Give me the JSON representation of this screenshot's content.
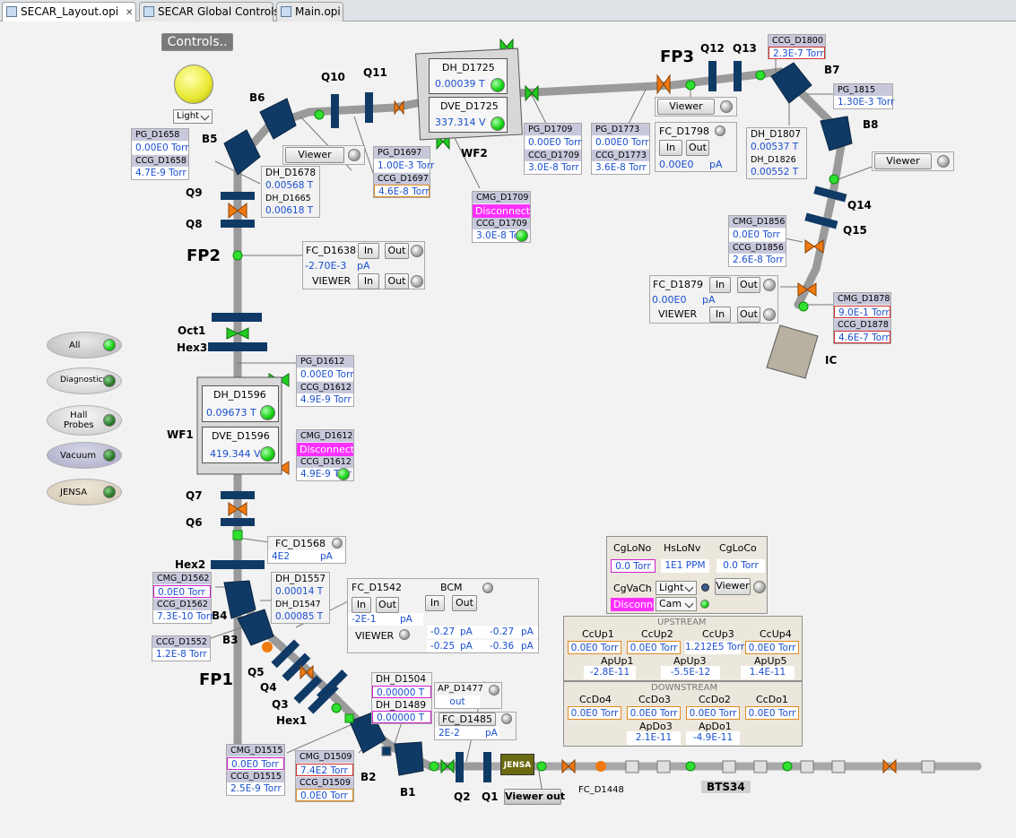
{
  "tabs": [
    {
      "label": "SECAR_Layout.opi"
    },
    {
      "label": "SECAR Global Controls"
    },
    {
      "label": "Main.opi"
    }
  ],
  "controls_btn": "Controls..",
  "light_select": "Light",
  "modes": [
    {
      "label": "All"
    },
    {
      "label": "Diagnostics"
    },
    {
      "label": "Hall\nProbes"
    },
    {
      "label": "Vacuum"
    },
    {
      "label": "JENSA"
    }
  ],
  "labels": {
    "B5": "B5",
    "B6": "B6",
    "Q9": "Q9",
    "Q8": "Q8",
    "FP2": "FP2",
    "Q10": "Q10",
    "Q11": "Q11",
    "WF2": "WF2",
    "FP3": "FP3",
    "Q12": "Q12",
    "Q13": "Q13",
    "B7": "B7",
    "B8": "B8",
    "Q14": "Q14",
    "Q15": "Q15",
    "IC": "IC",
    "Oct1": "Oct1",
    "Hex3": "Hex3",
    "WF1": "WF1",
    "Q7": "Q7",
    "Q6": "Q6",
    "Hex2": "Hex2",
    "B4": "B4",
    "B3": "B3",
    "FP1": "FP1",
    "Q5": "Q5",
    "Q4": "Q4",
    "Q3": "Q3",
    "Hex1": "Hex1",
    "B2": "B2",
    "B1": "B1",
    "Q2": "Q2",
    "Q1": "Q1",
    "BTS34": "BTS34",
    "FC_D1448": "FC_D1448"
  },
  "pg_d1658": {
    "h1": "PG_D1658",
    "v1": "0.00E0 Torr",
    "h2": "CCG_D1658",
    "v2": "4.7E-9 Torr"
  },
  "dh_d1678": {
    "h1": "DH_D1678",
    "v1": "0.00568 T",
    "h2": "DH_D1665",
    "v2": "0.00618 T"
  },
  "viewer1": "Viewer",
  "pg_d1697": {
    "h1": "PG_D1697",
    "v1": "1.00E-3 Torr",
    "h2": "CCG_D1697",
    "v2": "4.6E-8 Torr"
  },
  "wf2": {
    "dh": "DH_D1725",
    "dhv": "0.00039 T",
    "dve": "DVE_D1725",
    "dvev": "337.314 V"
  },
  "pg_d1709": {
    "h1": "PG_D1709",
    "v1": "0.00E0 Torr",
    "h2": "CCG_D1709",
    "v2": "3.0E-8 Torr"
  },
  "cmg_d1709": {
    "h1": "CMG_D1709",
    "v1": "Disconnected",
    "h2": "CCG_D1709",
    "v2": "3.0E-8 Torr"
  },
  "pg_d1773": {
    "h1": "PG_D1773",
    "v1": "0.00E0 Torr",
    "h2": "CCG_D1773",
    "v2": "3.6E-8 Torr"
  },
  "viewer2": "Viewer",
  "fc_d1798": {
    "name": "FC_D1798",
    "in": "In",
    "out": "Out",
    "val": "0.00E0",
    "unit": "pA"
  },
  "ccg_d1800": {
    "h1": "CCG_D1800",
    "v1": "2.3E-7 Torr"
  },
  "pg_1815": {
    "h1": "PG_1815",
    "v1": "1.30E-3 Torr"
  },
  "dh_d1807": {
    "h1": "DH_D1807",
    "v1": "0.00537 T",
    "h2": "DH_D1826",
    "v2": "0.00552 T"
  },
  "viewer3": "Viewer",
  "cmg_d1856": {
    "h1": "CMG_D1856",
    "v1": "0.0E0 Torr",
    "h2": "CCG_D1856",
    "v2": "2.6E-8 Torr"
  },
  "fc_d1879": {
    "name": "FC_D1879",
    "in": "In",
    "out": "Out",
    "val": "0.00E0",
    "unit": "pA",
    "viewer": "VIEWER",
    "vin": "In",
    "vout": "Out"
  },
  "cmg_d1878": {
    "h1": "CMG_D1878",
    "v1": "9.0E-1 Torr",
    "h2": "CCG_D1878",
    "v2": "4.6E-7 Torr"
  },
  "fc_d1638": {
    "name": "FC_D1638",
    "in": "In",
    "out": "Out",
    "val": "-2.70E-3",
    "unit": "pA",
    "viewer": "VIEWER",
    "vin": "In",
    "vout": "Out"
  },
  "pg_d1612": {
    "h1": "PG_D1612",
    "v1": "0.00E0 Torr",
    "h2": "CCG_D1612",
    "v2": "4.9E-9 Torr"
  },
  "wf1": {
    "dh": "DH_D1596",
    "dhv": "0.09673 T",
    "dve": "DVE_D1596",
    "dvev": "419.344 V"
  },
  "cmg_d1612": {
    "h1": "CMG_D1612",
    "v1": "Disconnected",
    "h2": "CCG_D1612",
    "v2": "4.9E-9 Torr"
  },
  "fc_d1568": {
    "name": "FC_D1568",
    "val": "4E2",
    "unit": "pA"
  },
  "cmg_d1562": {
    "h1": "CMG_D1562",
    "v1": "0.0E0 Torr",
    "h2": "CCG_D1562",
    "v2": "7.3E-10 Torr"
  },
  "dh_d1557": {
    "h1": "DH_D1557",
    "v1": "0.00014 T",
    "h2": "DH_D1547",
    "v2": "0.00085 T"
  },
  "ccg_d1552": {
    "h1": "CCG_D1552",
    "v1": "1.2E-8 Torr"
  },
  "fc_d1542": {
    "name": "FC_D1542",
    "in": "In",
    "out": "Out",
    "val": "-2E-1",
    "unit": "pA",
    "bcm": "BCM",
    "bin": "In",
    "bout": "Out",
    "viewer": "VIEWER",
    "c1": "-0.27",
    "c2": "pA",
    "c3": "-0.27",
    "c4": "pA",
    "c5": "-0.25",
    "c6": "pA",
    "c7": "-0.36",
    "c8": "pA"
  },
  "dh_d1504": {
    "h1": "DH_D1504",
    "v1": "0.00000 T",
    "h2": "DH_D1489",
    "v2": "0.00000 T"
  },
  "ap_d1477": {
    "h1": "AP_D1477",
    "v1": "out"
  },
  "fc_d1485": {
    "name": "FC_D1485",
    "val": "2E-2",
    "unit": "pA"
  },
  "cmg_d1515": {
    "h1": "CMG_D1515",
    "v1": "0.0E0 Torr",
    "h2": "CCG_D1515",
    "v2": "2.5E-9 Torr"
  },
  "cmg_d1509": {
    "h1": "CMG_D1509",
    "v1": "7.4E2 Torr",
    "h2": "CCG_D1509",
    "v2": "0.0E0 Torr"
  },
  "jensa_box": "JENSA",
  "viewer_out": "Viewer out",
  "global": {
    "h1": "CgLoNo",
    "h2": "HsLoNv",
    "h3": "CgLoCo",
    "v1": "0.0 Torr",
    "v2": "1E1 PPM",
    "v3": "0.0 Torr",
    "vach": "CgVaCh",
    "light": "Light",
    "dis": "Disconnected",
    "cam": "Cam",
    "viewer": "Viewer"
  },
  "upstream": {
    "title": "UPSTREAM",
    "h": [
      "CcUp1",
      "CcUp2",
      "CcUp3",
      "CcUp4"
    ],
    "v": [
      "0.0E0 Torr",
      "0.0E0 Torr",
      "1.212E5 Torr",
      "0.0E0 Torr"
    ],
    "ah": [
      "ApUp1",
      "ApUp3",
      "ApUp5"
    ],
    "av": [
      "-2.8E-11",
      "-5.5E-12",
      "1.4E-11"
    ]
  },
  "downstream": {
    "title": "DOWNSTREAM",
    "h": [
      "CcDo4",
      "CcDo3",
      "CcDo2",
      "CcDo1"
    ],
    "v": [
      "0.0E0 Torr",
      "0.0E0 Torr",
      "0.0E0 Torr",
      "0.0E0 Torr"
    ],
    "ah": [
      "ApDo3",
      "ApDo1"
    ],
    "av": [
      "2.1E-11",
      "-4.9E-11"
    ]
  },
  "colors": {
    "beam": "#9a9a9a",
    "magnet": "#103a66",
    "valve_green": "#22cc22",
    "valve_orange": "#f07a10",
    "disconnected": "#ff30ff"
  }
}
